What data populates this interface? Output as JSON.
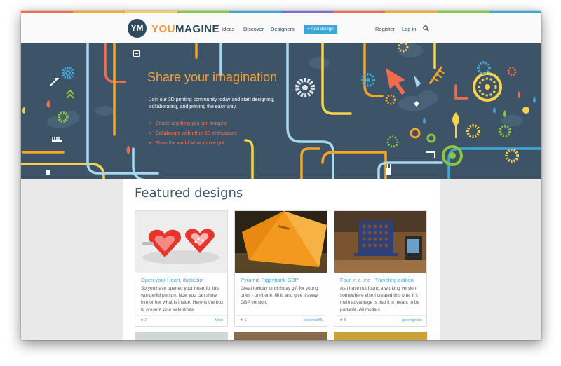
{
  "colors": {
    "stripe": [
      "#f16c4f",
      "#f5a623",
      "#f8d24a",
      "#8cc63f",
      "#3fa7d8",
      "#7b6fc4",
      "#f16c4f",
      "#f5a623",
      "#8cc63f",
      "#3fa7d8"
    ],
    "hero_bg": "#3d5468",
    "accent_orange": "#f4a33a",
    "accent_blue": "#3fa7d8",
    "bullet_red": "#f0784f"
  },
  "header": {
    "logo_text": "YM",
    "brand_part1": "YOU",
    "brand_part2": "MAGINE",
    "nav": {
      "ideas": "Ideas",
      "discover": "Discover",
      "designers": "Designers",
      "add_design": "+ Add design",
      "register": "Register",
      "login": "Log in"
    },
    "search_icon": "search-icon"
  },
  "hero": {
    "title": "Share your imagination",
    "intro": "Join our 3D printing community today and start designing, collaborating, and printing the easy way.",
    "bullets": [
      "Create anything you can imagine",
      "Collaborate with other 3D enthusiasts",
      "Show the world what you've got"
    ]
  },
  "featured": {
    "heading": "Featured designs",
    "cards": [
      {
        "title": "Open your Heart, dualcolor",
        "description": "So you have opened your heart for this wonderful person. Now you can show him or her what is inside. Here is the box to present your Valentines",
        "likes": "★ 2",
        "author": "Moxi"
      },
      {
        "title": "Pyramid Piggybank GBP",
        "description": "Great holiday or birthday gift for young ones - print one, fill it, and give it away. GBP version.",
        "likes": "★ 1",
        "author": "cocomor55"
      },
      {
        "title": "Four in a line - Traveling edition",
        "description": "As I have not found a working version somewhere else I created this one. It's main advantage is that it is meant to be portable. All models",
        "likes": "★ 5",
        "author": "greengecko"
      }
    ]
  }
}
